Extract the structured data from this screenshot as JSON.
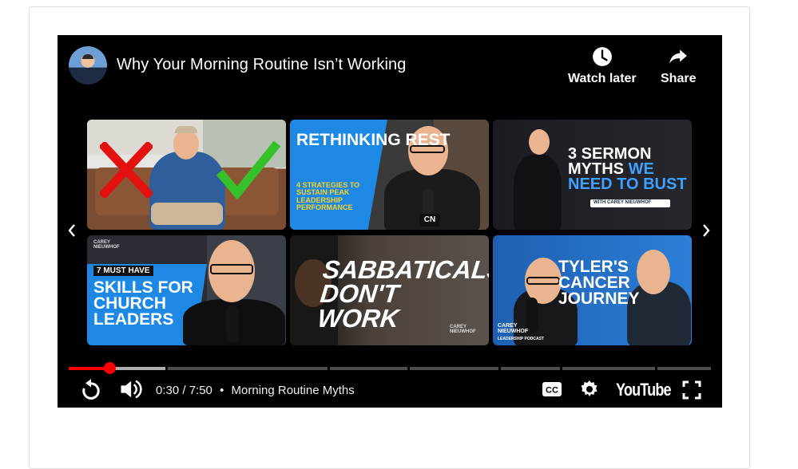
{
  "video": {
    "title": "Why Your Morning Routine Isn’t Working",
    "watch_later_label": "Watch later",
    "share_label": "Share"
  },
  "endscreen": {
    "tiles": [
      {
        "text": "",
        "icons": [
          "red-x-icon",
          "green-check-icon"
        ]
      },
      {
        "title": "RETHINKING REST",
        "subtitle": "4 STRATEGIES TO SUSTAIN PEAK LEADERSHIP PERFORMANCE",
        "badge": "CN"
      },
      {
        "title_white": "3 SERMON MYTHS",
        "title_blue": "WE",
        "title_line3": "NEED TO BUST",
        "byline": "WITH CAREY NIEUWHOF"
      },
      {
        "brand": "CAREY NIEUWHOF",
        "kicker": "7 MUST HAVE",
        "title": "SKILLS FOR CHURCH LEADERS"
      },
      {
        "title": "SABBATICALS DON'T WORK",
        "brand": "CAREY NIEUWHOF"
      },
      {
        "title": "TYLER'S CANCER JOURNEY",
        "brand": "CAREY NIEUWHOF",
        "brand_sub": "LEADERSHIP PODCAST"
      }
    ],
    "prev_icon": "chevron-left-icon",
    "next_icon": "chevron-right-icon"
  },
  "controls": {
    "current_time": "0:30",
    "duration": "7:50",
    "time_display": "0:30 / 7:50",
    "separator": "•",
    "chapter": "Morning Routine Myths",
    "progress_fraction": 0.064,
    "buffered_fraction": 0.151,
    "chapter_marker_fractions": [
      0.151,
      0.403,
      0.527,
      0.669,
      0.765,
      0.913
    ],
    "logo_text": "YouTube",
    "icons": [
      "replay-icon",
      "volume-icon",
      "captions-icon",
      "settings-icon",
      "youtube-logo",
      "fullscreen-icon"
    ]
  },
  "colors": {
    "progress": "#ff0000",
    "blue_accent": "#1e88e5",
    "player_bg": "#000000"
  }
}
